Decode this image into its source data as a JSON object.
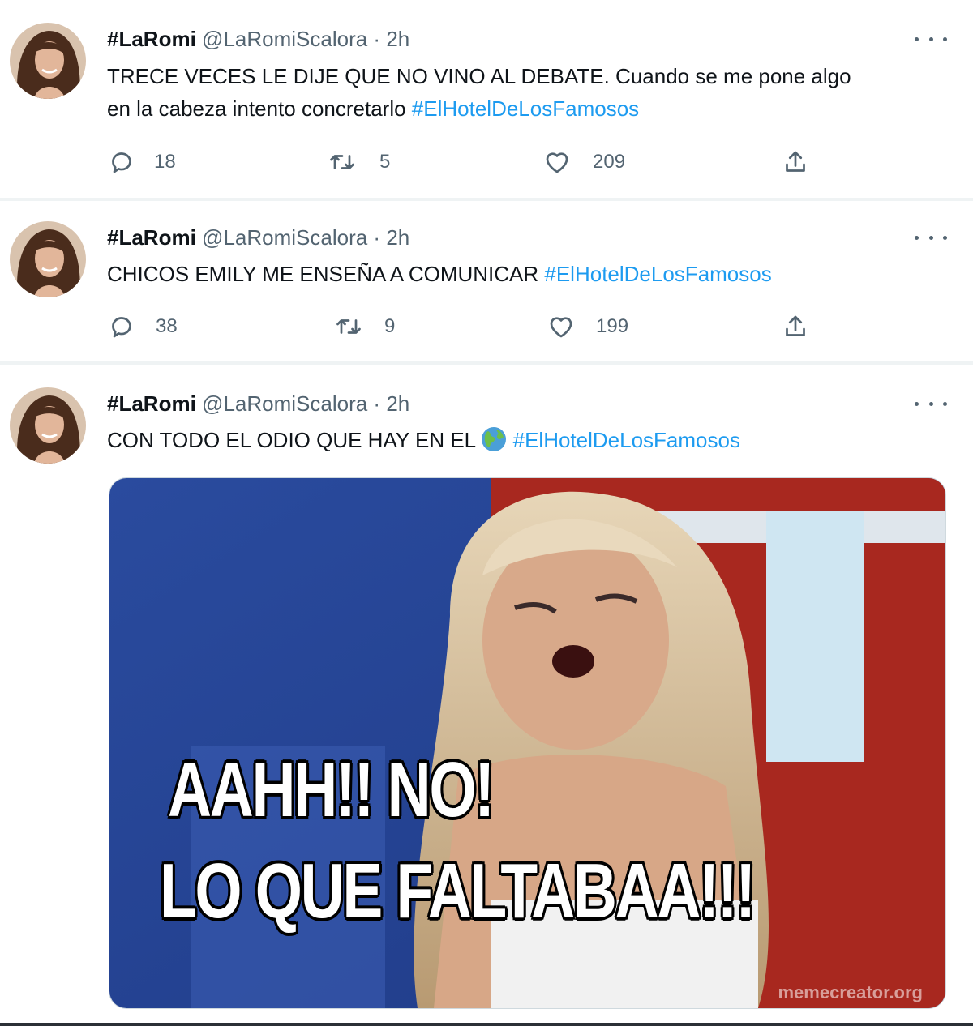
{
  "tweets": [
    {
      "name": "#LaRomi",
      "handle": "@LaRomiScalora",
      "separator": "·",
      "time": "2h",
      "text_line1": "TRECE VECES LE DIJE QUE NO VINO AL DEBATE. Cuando se me pone algo",
      "text_line2": "en la cabeza intento concretarlo ",
      "hashtag": "#ElHotelDeLosFamosos",
      "replies": "18",
      "retweets": "5",
      "likes": "209"
    },
    {
      "name": "#LaRomi",
      "handle": "@LaRomiScalora",
      "separator": "·",
      "time": "2h",
      "text_line1": "CHICOS EMILY ME ENSEÑA A COMUNICAR ",
      "hashtag": "#ElHotelDeLosFamosos",
      "replies": "38",
      "retweets": "9",
      "likes": "199"
    },
    {
      "name": "#LaRomi",
      "handle": "@LaRomiScalora",
      "separator": "·",
      "time": "2h",
      "text_line1": "CON TODO EL ODIO QUE HAY EN EL ",
      "emoji": "globe-emoji",
      "hashtag": "#ElHotelDeLosFamosos",
      "media": {
        "caption_line1": "AAHH!! NO!",
        "caption_line2": "LO QUE FALTABAA!!!",
        "watermark": "memecreator.org"
      }
    }
  ],
  "icons": [
    "reply-icon",
    "retweet-icon",
    "like-icon",
    "share-icon",
    "more-icon",
    "avatar"
  ],
  "colors": {
    "hashtag": "#1d9bf0",
    "secondary": "#536471",
    "text": "#0f1419"
  }
}
